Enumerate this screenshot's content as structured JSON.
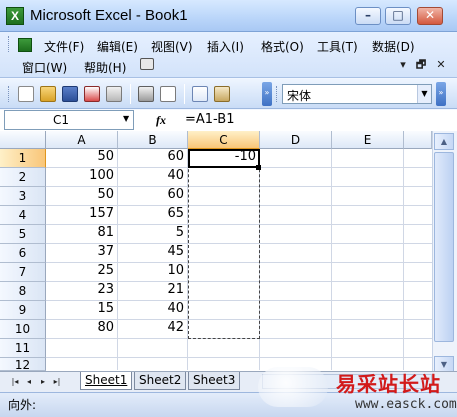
{
  "window": {
    "app_icon": "X",
    "title": "Microsoft Excel - Book1",
    "minimize_label": "–",
    "maximize_label": "□",
    "close_label": "✕"
  },
  "menu": {
    "items": [
      "文件(F)",
      "编辑(E)",
      "视图(V)",
      "插入(I)",
      "格式(O)",
      "工具(T)",
      "数据(D)"
    ],
    "items_row2": [
      "窗口(W)",
      "帮助(H)"
    ],
    "mdi_controls": [
      "▾",
      "🗗",
      "✕"
    ]
  },
  "toolbar": {
    "icons": [
      "new-icon",
      "open-icon",
      "save-icon",
      "permission-icon",
      "email-icon",
      "print-icon",
      "print-preview-icon",
      "spelling-icon",
      "research-icon"
    ],
    "font_name": "宋体"
  },
  "formula_bar": {
    "name_box": "C1",
    "fx": "fx",
    "formula": "=A1-B1"
  },
  "sheet": {
    "columns": [
      "A",
      "B",
      "C",
      "D",
      "E"
    ],
    "active_column": "C",
    "row_numbers": [
      "1",
      "2",
      "3",
      "4",
      "5",
      "6",
      "7",
      "8",
      "9",
      "10",
      "11",
      "12"
    ],
    "active_row": "1",
    "col_A": [
      "50",
      "100",
      "50",
      "157",
      "81",
      "37",
      "25",
      "23",
      "15",
      "80"
    ],
    "col_B": [
      "60",
      "40",
      "60",
      "65",
      "5",
      "45",
      "10",
      "21",
      "40",
      "42"
    ],
    "col_C": [
      "-10"
    ]
  },
  "tabs": {
    "nav": [
      "|◂",
      "◂",
      "▸",
      "▸|"
    ],
    "sheets": [
      "Sheet1",
      "Sheet2",
      "Sheet3"
    ],
    "active": "Sheet1"
  },
  "status": {
    "text": "向外:"
  },
  "watermark": {
    "chinese": "易采站长站",
    "url": "www.easck.com"
  },
  "colors": {
    "active_header": "#f9c679",
    "grid_line": "#d0d7e5",
    "watermark_red": "#d21a1a"
  }
}
